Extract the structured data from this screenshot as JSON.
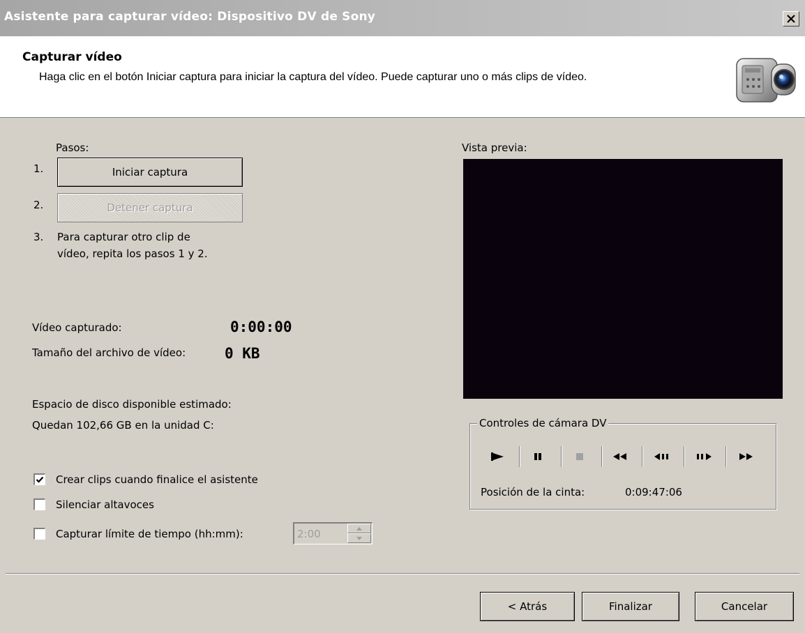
{
  "window": {
    "title": "Asistente para capturar vídeo: Dispositivo DV de Sony",
    "close_label": "×"
  },
  "header": {
    "title": "Capturar vídeo",
    "description": "Haga clic en el botón Iniciar captura para iniciar la captura del vídeo. Puede capturar uno o más clips de vídeo."
  },
  "steps": {
    "label": "Pasos:",
    "step1_num": "1.",
    "start_capture": "Iniciar captura",
    "step2_num": "2.",
    "stop_capture": "Detener captura",
    "step3_num": "3.",
    "step3_text_line1": "Para capturar otro clip de",
    "step3_text_line2": "vídeo, repita los pasos 1 y 2."
  },
  "stats": {
    "captured_label": "Vídeo capturado:",
    "captured_value": "0:00:00",
    "size_label": "Tamaño del archivo de vídeo:",
    "size_value": "0 KB",
    "disk_label": "Espacio de disco disponible estimado:",
    "disk_value": "Quedan 102,66 GB en la unidad C:"
  },
  "options": {
    "create_clips": "Crear clips cuando finalice el asistente",
    "create_clips_checked": true,
    "mute_speakers": "Silenciar altavoces",
    "mute_speakers_checked": false,
    "time_limit": "Capturar límite de tiempo (hh:mm):",
    "time_limit_checked": false,
    "time_limit_value": "2:00"
  },
  "preview": {
    "label": "Vista previa:"
  },
  "camera_controls": {
    "title": "Controles de cámara DV",
    "controls": [
      "play-icon",
      "pause-icon",
      "stop-icon",
      "rewind-icon",
      "previous-frame-icon",
      "next-frame-icon",
      "fast-forward-icon"
    ],
    "tape_position_label": "Posición de la cinta:",
    "tape_position_value": "0:09:47:06"
  },
  "footer": {
    "back": "< Atrás",
    "finish": "Finalizar",
    "cancel": "Cancelar"
  },
  "colors": {
    "preview_bg": "#0a030d",
    "dialog_bg": "#d4d0c8",
    "title_bar": "#a6a6a6"
  }
}
